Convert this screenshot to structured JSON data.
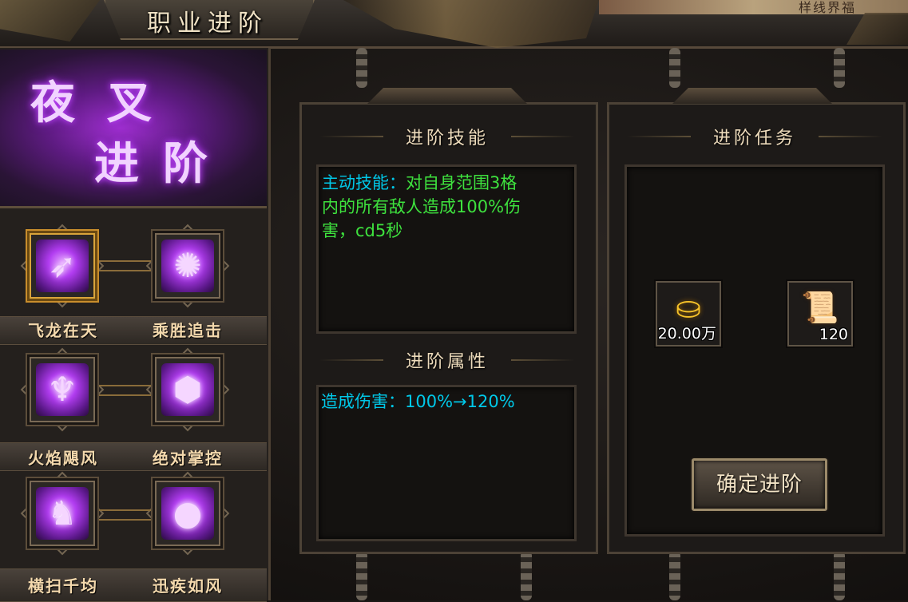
{
  "window": {
    "title": "职业进阶",
    "top_right_text": "样线界福"
  },
  "banner": {
    "line1": "夜叉",
    "line2": "进阶"
  },
  "skills": [
    {
      "label": "飞龙在天",
      "icon": "purple-wing-icon"
    },
    {
      "label": "乘胜追击",
      "icon": "purple-vortex-icon"
    },
    {
      "label": "火焰飓风",
      "icon": "purple-demon-icon"
    },
    {
      "label": "绝对掌控",
      "icon": "purple-emblem-icon"
    },
    {
      "label": "横扫千均",
      "icon": "purple-beast-icon"
    },
    {
      "label": "迅疾如风",
      "icon": "purple-orb-icon"
    }
  ],
  "selected_skill": "飞龙在天",
  "skill_section": {
    "title": "进阶技能",
    "line1_prefix": "主动技能：",
    "line1_rest": "对自身范围3格",
    "line2": "内的所有敌人造成100%伤",
    "line3": "害，cd5秒"
  },
  "attr_section": {
    "title": "进阶属性",
    "text": "造成伤害：100%→120%"
  },
  "task_section": {
    "title": "进阶任务",
    "items": [
      {
        "icon": "gold-ingot-icon",
        "count": "20.00万"
      },
      {
        "icon": "scroll-icon",
        "count": "120"
      }
    ]
  },
  "confirm_button": "确定进阶",
  "colors": {
    "accent_gold": "#d9a43a",
    "skill_cyan": "#00c8e8",
    "skill_green": "#3ee23e",
    "banner_purple": "#9e2fcf"
  }
}
